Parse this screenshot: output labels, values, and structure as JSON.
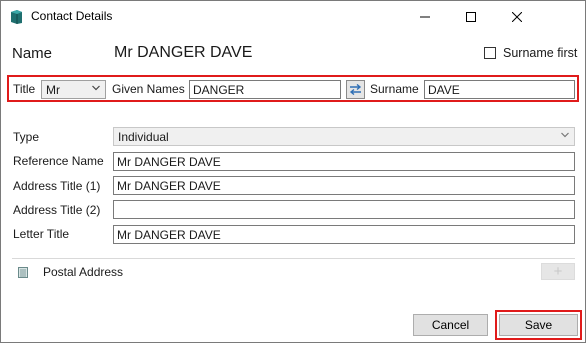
{
  "window": {
    "title": "Contact Details",
    "controls": [
      "minimize-icon",
      "maximize-icon",
      "close-icon"
    ]
  },
  "header": {
    "name_label": "Name",
    "name_value": "Mr DANGER DAVE",
    "surname_first_label": "Surname first",
    "surname_first_checked": false
  },
  "name_row": {
    "title_label": "Title",
    "title_value": "Mr",
    "given_names_label": "Given Names",
    "given_names_value": "DANGER",
    "swap_icon": "swap-arrows-icon",
    "surname_label": "Surname",
    "surname_value": "DAVE"
  },
  "details": {
    "type_label": "Type",
    "type_value": "Individual",
    "reference_name_label": "Reference Name",
    "reference_name_value": "Mr DANGER DAVE",
    "address_title_1_label": "Address Title (1)",
    "address_title_1_value": "Mr DANGER DAVE",
    "address_title_2_label": "Address Title (2)",
    "address_title_2_value": "",
    "letter_title_label": "Letter Title",
    "letter_title_value": "Mr DANGER DAVE"
  },
  "address": {
    "postal_label": "Postal Address",
    "add_label": "+"
  },
  "footer": {
    "cancel_label": "Cancel",
    "save_label": "Save"
  },
  "colors": {
    "highlight": "#e01b1b",
    "swap_blue": "#2f6fb5",
    "app_icon": "#2a8c8c"
  }
}
